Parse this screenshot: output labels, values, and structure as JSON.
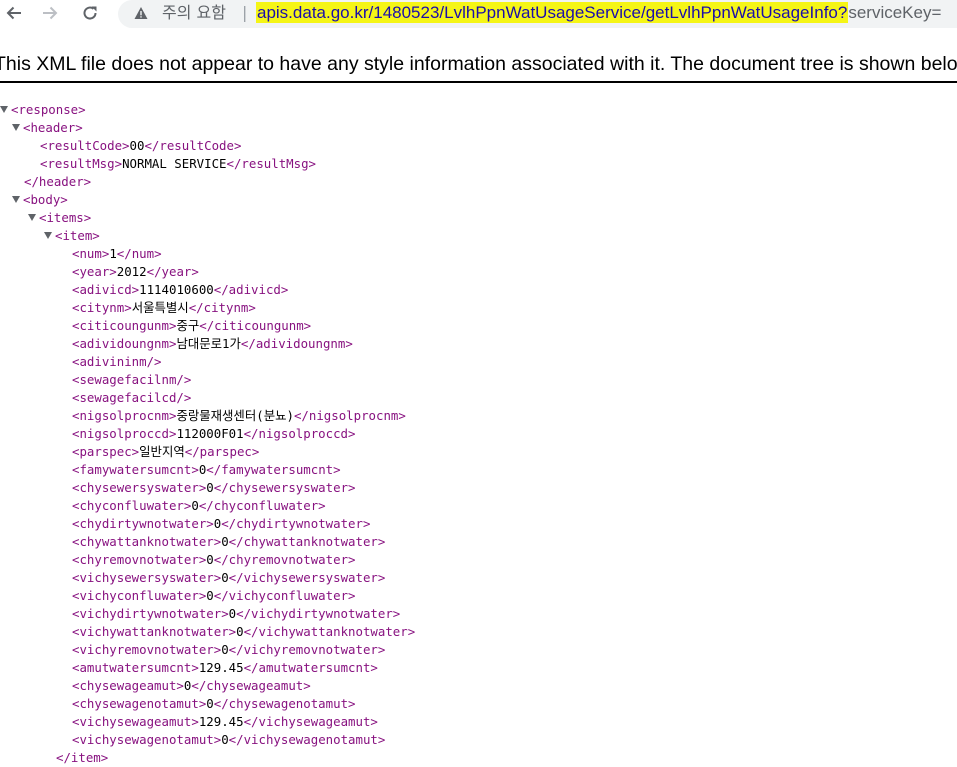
{
  "browser": {
    "security_label": "주의 요함",
    "separator": "|",
    "url_highlight": "apis.data.go.kr/1480523/LvlhPpnWatUsageService/getLvlhPpnWatUsageInfo?",
    "url_rest": "serviceKey=",
    "highlight_color": "#f5f516"
  },
  "notice": "This XML file does not appear to have any style information associated with it. The document tree is shown below.",
  "xml": {
    "response_open": "<response>",
    "header_open": "<header>",
    "header_close": "</header>",
    "body_open": "<body>",
    "items_open": "<items>",
    "item_open": "<item>",
    "resultCode": {
      "open": "<resultCode>",
      "value": "00",
      "close": "</resultCode>"
    },
    "resultMsg": {
      "open": "<resultMsg>",
      "value": "NORMAL SERVICE",
      "close": "</resultMsg>"
    },
    "fields": [
      {
        "open": "<num>",
        "value": "1",
        "close": "</num>"
      },
      {
        "open": "<year>",
        "value": "2012",
        "close": "</year>"
      },
      {
        "open": "<adivicd>",
        "value": "1114010600",
        "close": "</adivicd>"
      },
      {
        "open": "<citynm>",
        "value": "서울특별시",
        "close": "</citynm>"
      },
      {
        "open": "<citicoungunm>",
        "value": "중구",
        "close": "</citicoungunm>"
      },
      {
        "open": "<adividoungnm>",
        "value": "남대문로1가",
        "close": "</adividoungnm>"
      },
      {
        "open": "<adivininm/>",
        "value": "",
        "close": ""
      },
      {
        "open": "<sewagefacilnm/>",
        "value": "",
        "close": ""
      },
      {
        "open": "<sewagefacilcd/>",
        "value": "",
        "close": ""
      },
      {
        "open": "<nigsolprocnm>",
        "value": "중랑물재생센터(분뇨)",
        "close": "</nigsolprocnm>"
      },
      {
        "open": "<nigsolproccd>",
        "value": "112000F01",
        "close": "</nigsolproccd>"
      },
      {
        "open": "<parspec>",
        "value": "일반지역",
        "close": "</parspec>"
      },
      {
        "open": "<famywatersumcnt>",
        "value": "0",
        "close": "</famywatersumcnt>"
      },
      {
        "open": "<chysewersyswater>",
        "value": "0",
        "close": "</chysewersyswater>"
      },
      {
        "open": "<chyconfluwater>",
        "value": "0",
        "close": "</chyconfluwater>"
      },
      {
        "open": "<chydirtywnotwater>",
        "value": "0",
        "close": "</chydirtywnotwater>"
      },
      {
        "open": "<chywattanknotwater>",
        "value": "0",
        "close": "</chywattanknotwater>"
      },
      {
        "open": "<chyremovnotwater>",
        "value": "0",
        "close": "</chyremovnotwater>"
      },
      {
        "open": "<vichysewersyswater>",
        "value": "0",
        "close": "</vichysewersyswater>"
      },
      {
        "open": "<vichyconfluwater>",
        "value": "0",
        "close": "</vichyconfluwater>"
      },
      {
        "open": "<vichydirtywnotwater>",
        "value": "0",
        "close": "</vichydirtywnotwater>"
      },
      {
        "open": "<vichywattanknotwater>",
        "value": "0",
        "close": "</vichywattanknotwater>"
      },
      {
        "open": "<vichyremovnotwater>",
        "value": "0",
        "close": "</vichyremovnotwater>"
      },
      {
        "open": "<amutwatersumcnt>",
        "value": "129.45",
        "close": "</amutwatersumcnt>"
      },
      {
        "open": "<chysewageamut>",
        "value": "0",
        "close": "</chysewageamut>"
      },
      {
        "open": "<chysewagenotamut>",
        "value": "0",
        "close": "</chysewagenotamut>"
      },
      {
        "open": "<vichysewageamut>",
        "value": "129.45",
        "close": "</vichysewageamut>"
      },
      {
        "open": "<vichysewagenotamut>",
        "value": "0",
        "close": "</vichysewagenotamut>"
      }
    ],
    "item_close": "</item>"
  }
}
